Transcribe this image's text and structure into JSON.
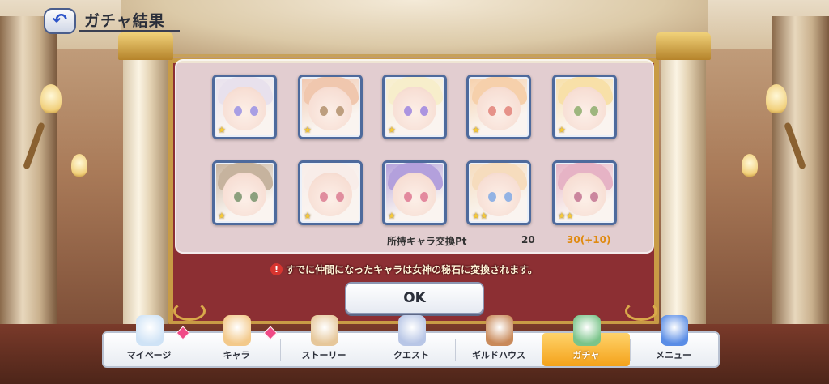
{
  "header": {
    "back_icon": "back-arrow-icon",
    "title": "ガチャ結果"
  },
  "results": {
    "cards": [
      {
        "name": "character-card-1",
        "hair": "#dcd2e4",
        "eyes": "#7a6bd6",
        "stars": "★"
      },
      {
        "name": "character-card-2",
        "hair": "#e9a983",
        "eyes": "#9a6a3a",
        "stars": "★"
      },
      {
        "name": "character-card-3",
        "hair": "#f3e5b0",
        "eyes": "#7e5bd0",
        "stars": "★"
      },
      {
        "name": "character-card-4",
        "hair": "#f2b77e",
        "eyes": "#d9584a",
        "stars": "★"
      },
      {
        "name": "character-card-5",
        "hair": "#f5cf7a",
        "eyes": "#6a8f3a",
        "stars": "★"
      },
      {
        "name": "character-card-6",
        "hair": "#a88a6a",
        "eyes": "#4f6e3a",
        "stars": "★"
      },
      {
        "name": "character-card-7",
        "hair": "#f4e3dd",
        "eyes": "#d0506a",
        "stars": "★"
      },
      {
        "name": "character-card-8",
        "hair": "#8a6dc9",
        "eyes": "#d44a6a",
        "stars": "★"
      },
      {
        "name": "character-card-9",
        "hair": "#f1c99a",
        "eyes": "#5a8ad6",
        "stars": "★★"
      },
      {
        "name": "character-card-10",
        "hair": "#d98aa6",
        "eyes": "#b0466a",
        "stars": "★★"
      }
    ],
    "pt_label": "所持キャラ交換Pt",
    "pt_current": "20",
    "pt_new": "30(+10)"
  },
  "notice": {
    "icon": "!",
    "text": "すでに仲間になったキャラは女神の秘石に変換されます。"
  },
  "ok_button": "OK",
  "nav": {
    "items": [
      {
        "label": "マイページ",
        "icon": "castle-icon",
        "color": "#cfe3f6",
        "badge": true
      },
      {
        "label": "キャラ",
        "icon": "character-icon",
        "color": "#f3c98a",
        "badge": true
      },
      {
        "label": "ストーリー",
        "icon": "scroll-icon",
        "color": "#e6c79a",
        "badge": false
      },
      {
        "label": "クエスト",
        "icon": "sword-flag-icon",
        "color": "#b8c6e6",
        "badge": false
      },
      {
        "label": "ギルドハウス",
        "icon": "chair-icon",
        "color": "#c98a5a",
        "badge": false
      },
      {
        "label": "ガチャ",
        "icon": "gacha-icon",
        "color": "#7ac48a",
        "badge": false,
        "active": true
      },
      {
        "label": "メニュー",
        "icon": "crystal-icon",
        "color": "#5a8de6",
        "badge": false
      }
    ]
  },
  "colors": {
    "accent": "#2e55c9",
    "pt_highlight": "#e08a10",
    "active_tab": "#f4a21a",
    "notice_icon": "#d8352f"
  }
}
